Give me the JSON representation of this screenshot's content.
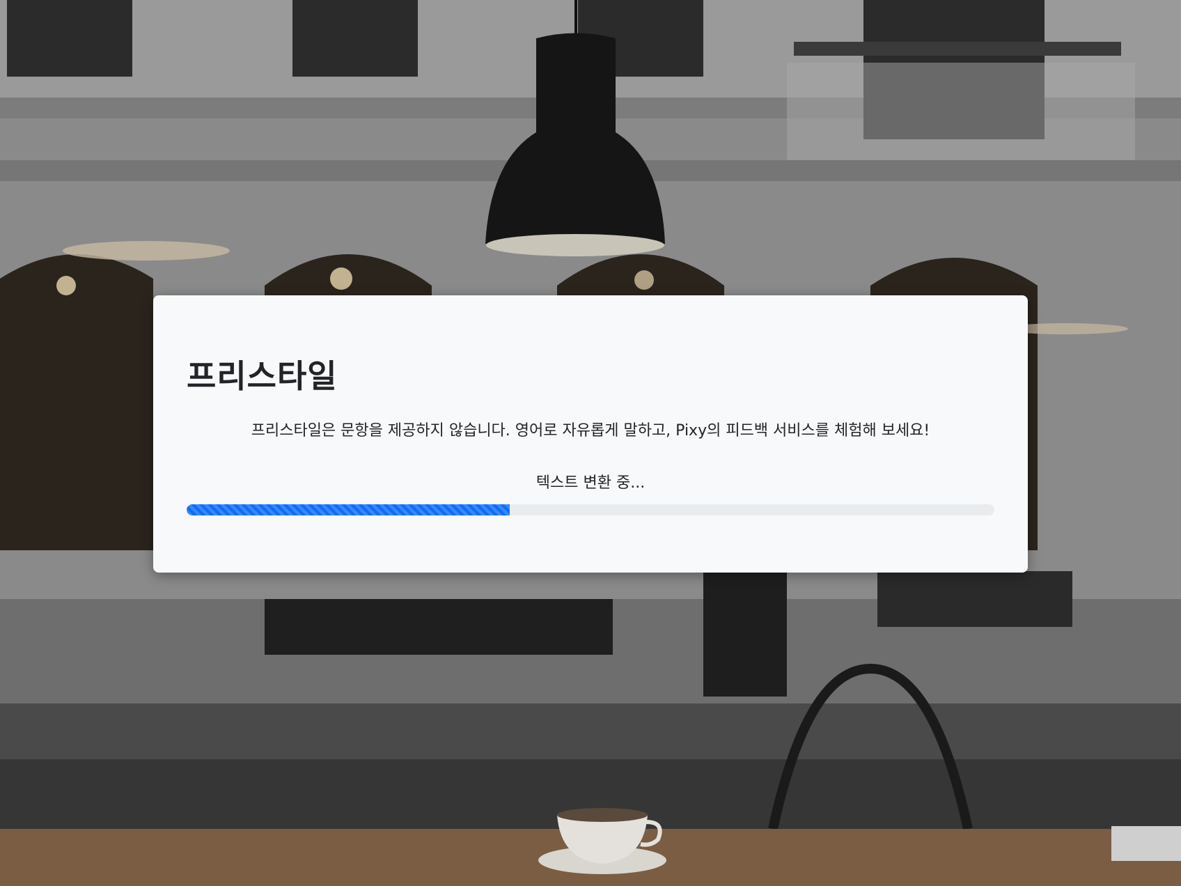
{
  "modal": {
    "title": "프리스타일",
    "description": "프리스타일은 문항을 제공하지 않습니다. 영어로 자유롭게 말하고, Pixy의 피드백 서비스를 체험해 보세요!",
    "status": "텍스트 변환 중...",
    "progress_fraction": 0.4
  },
  "colors": {
    "progress_fill": "#0d6efd",
    "progress_track": "#e9ecef",
    "modal_background": "#f8f9fa",
    "text": "#212529"
  }
}
